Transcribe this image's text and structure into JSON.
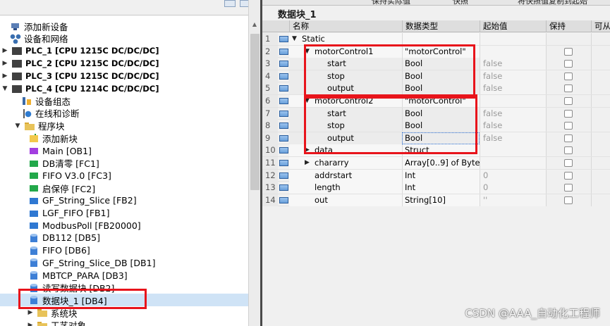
{
  "tree": {
    "items": [
      {
        "label": "添加新设备",
        "icon": "add-device-icon",
        "kind": "device",
        "toggle": ""
      },
      {
        "label": "设备和网络",
        "icon": "network-icon",
        "kind": "net",
        "toggle": ""
      },
      {
        "label": "PLC_1 [CPU 1215C DC/DC/DC]",
        "icon": "plc-icon",
        "kind": "plc",
        "toggle": "▶"
      },
      {
        "label": "PLC_2 [CPU 1215C DC/DC/DC]",
        "icon": "plc-icon",
        "kind": "plc",
        "toggle": "▶"
      },
      {
        "label": "PLC_3 [CPU 1215C DC/DC/DC]",
        "icon": "plc-icon",
        "kind": "plc",
        "toggle": "▶"
      },
      {
        "label": "PLC_4 [CPU 1214C DC/DC/DC]",
        "icon": "plc-icon",
        "kind": "plc",
        "toggle": "▼"
      },
      {
        "label": "设备组态",
        "icon": "device-config-icon",
        "kind": "cfg",
        "toggle": ""
      },
      {
        "label": "在线和诊断",
        "icon": "diagnostics-icon",
        "kind": "diag",
        "toggle": ""
      },
      {
        "label": "程序块",
        "icon": "folder-icon",
        "kind": "folder",
        "toggle": "▼"
      },
      {
        "label": "添加新块",
        "icon": "add-block-icon",
        "kind": "add",
        "toggle": ""
      },
      {
        "label": "Main [OB1]",
        "icon": "ob-block-icon",
        "kind": "ob",
        "toggle": ""
      },
      {
        "label": "DB清零 [FC1]",
        "icon": "fc-block-icon",
        "kind": "fc",
        "toggle": ""
      },
      {
        "label": "FIFO V3.0 [FC3]",
        "icon": "fc-block-icon",
        "kind": "fc",
        "toggle": ""
      },
      {
        "label": "启保停 [FC2]",
        "icon": "fc-block-icon",
        "kind": "fc",
        "toggle": ""
      },
      {
        "label": "GF_String_Slice [FB2]",
        "icon": "fb-block-icon",
        "kind": "fb",
        "toggle": ""
      },
      {
        "label": "LGF_FIFO [FB1]",
        "icon": "fb-block-icon",
        "kind": "fb",
        "toggle": ""
      },
      {
        "label": "ModbusPoll [FB20000]",
        "icon": "fb-block-icon",
        "kind": "fb",
        "toggle": ""
      },
      {
        "label": "DB112 [DB5]",
        "icon": "db-block-icon",
        "kind": "db",
        "toggle": ""
      },
      {
        "label": "FIFO [DB6]",
        "icon": "db-block-icon",
        "kind": "db",
        "toggle": ""
      },
      {
        "label": "GF_String_Slice_DB [DB1]",
        "icon": "db-block-icon",
        "kind": "db",
        "toggle": ""
      },
      {
        "label": "MBTCP_PARA [DB3]",
        "icon": "db-block-icon",
        "kind": "db",
        "toggle": ""
      },
      {
        "label": "读写数据块 [DB2]",
        "icon": "db-block-icon",
        "kind": "db",
        "toggle": ""
      },
      {
        "label": "数据块_1 [DB4]",
        "icon": "db-block-icon",
        "kind": "db",
        "toggle": "",
        "selected": true
      },
      {
        "label": "系统块",
        "icon": "folder-icon",
        "kind": "folder",
        "toggle": "▶"
      },
      {
        "label": "工艺对象",
        "icon": "folder-icon",
        "kind": "folder",
        "toggle": "▶"
      }
    ]
  },
  "editor": {
    "toolbar": {
      "keep_actual": "保持实际值",
      "snapshot": "快照",
      "copy_snapshot": "将快照值复制到起始"
    },
    "title": "数据块_1",
    "columns": {
      "name": "名称",
      "type": "数据类型",
      "start": "起始值",
      "retain": "保持",
      "accessible": "可从"
    },
    "rows": [
      {
        "num": "1",
        "name": "Static",
        "type": "",
        "start": "",
        "toggle": "▼",
        "level": 0,
        "checkbox": false
      },
      {
        "num": "2",
        "name": "motorControl1",
        "type": "\"motorControl\"",
        "start": "",
        "toggle": "▼",
        "level": 1,
        "checkbox": true
      },
      {
        "num": "3",
        "name": "start",
        "type": "Bool",
        "start": "false",
        "toggle": "",
        "level": 2,
        "checkbox": true
      },
      {
        "num": "4",
        "name": "stop",
        "type": "Bool",
        "start": "false",
        "toggle": "",
        "level": 2,
        "checkbox": true
      },
      {
        "num": "5",
        "name": "output",
        "type": "Bool",
        "start": "false",
        "toggle": "",
        "level": 2,
        "checkbox": true
      },
      {
        "num": "6",
        "name": "motorControl2",
        "type": "\"motorControl\"",
        "start": "",
        "toggle": "▼",
        "level": 1,
        "checkbox": true
      },
      {
        "num": "7",
        "name": "start",
        "type": "Bool",
        "start": "false",
        "toggle": "",
        "level": 2,
        "checkbox": true
      },
      {
        "num": "8",
        "name": "stop",
        "type": "Bool",
        "start": "false",
        "toggle": "",
        "level": 2,
        "checkbox": true
      },
      {
        "num": "9",
        "name": "output",
        "type": "Bool",
        "start": "false",
        "toggle": "",
        "level": 2,
        "checkbox": true
      },
      {
        "num": "10",
        "name": "data",
        "type": "Struct",
        "start": "",
        "toggle": "▶",
        "level": 1,
        "checkbox": true
      },
      {
        "num": "11",
        "name": "chararry",
        "type": "Array[0..9] of Byte",
        "start": "",
        "toggle": "▶",
        "level": 1,
        "checkbox": true
      },
      {
        "num": "12",
        "name": "addrstart",
        "type": "Int",
        "start": "0",
        "toggle": "",
        "level": 1,
        "checkbox": true
      },
      {
        "num": "13",
        "name": "length",
        "type": "Int",
        "start": "0",
        "toggle": "",
        "level": 1,
        "checkbox": true
      },
      {
        "num": "14",
        "name": "out",
        "type": "String[10]",
        "start": "''",
        "toggle": "",
        "level": 1,
        "checkbox": true
      }
    ]
  },
  "watermark": "CSDN @AAA_自动化工程师",
  "colors": {
    "highlight": "#e8141b",
    "selection": "#cfe3f6"
  }
}
